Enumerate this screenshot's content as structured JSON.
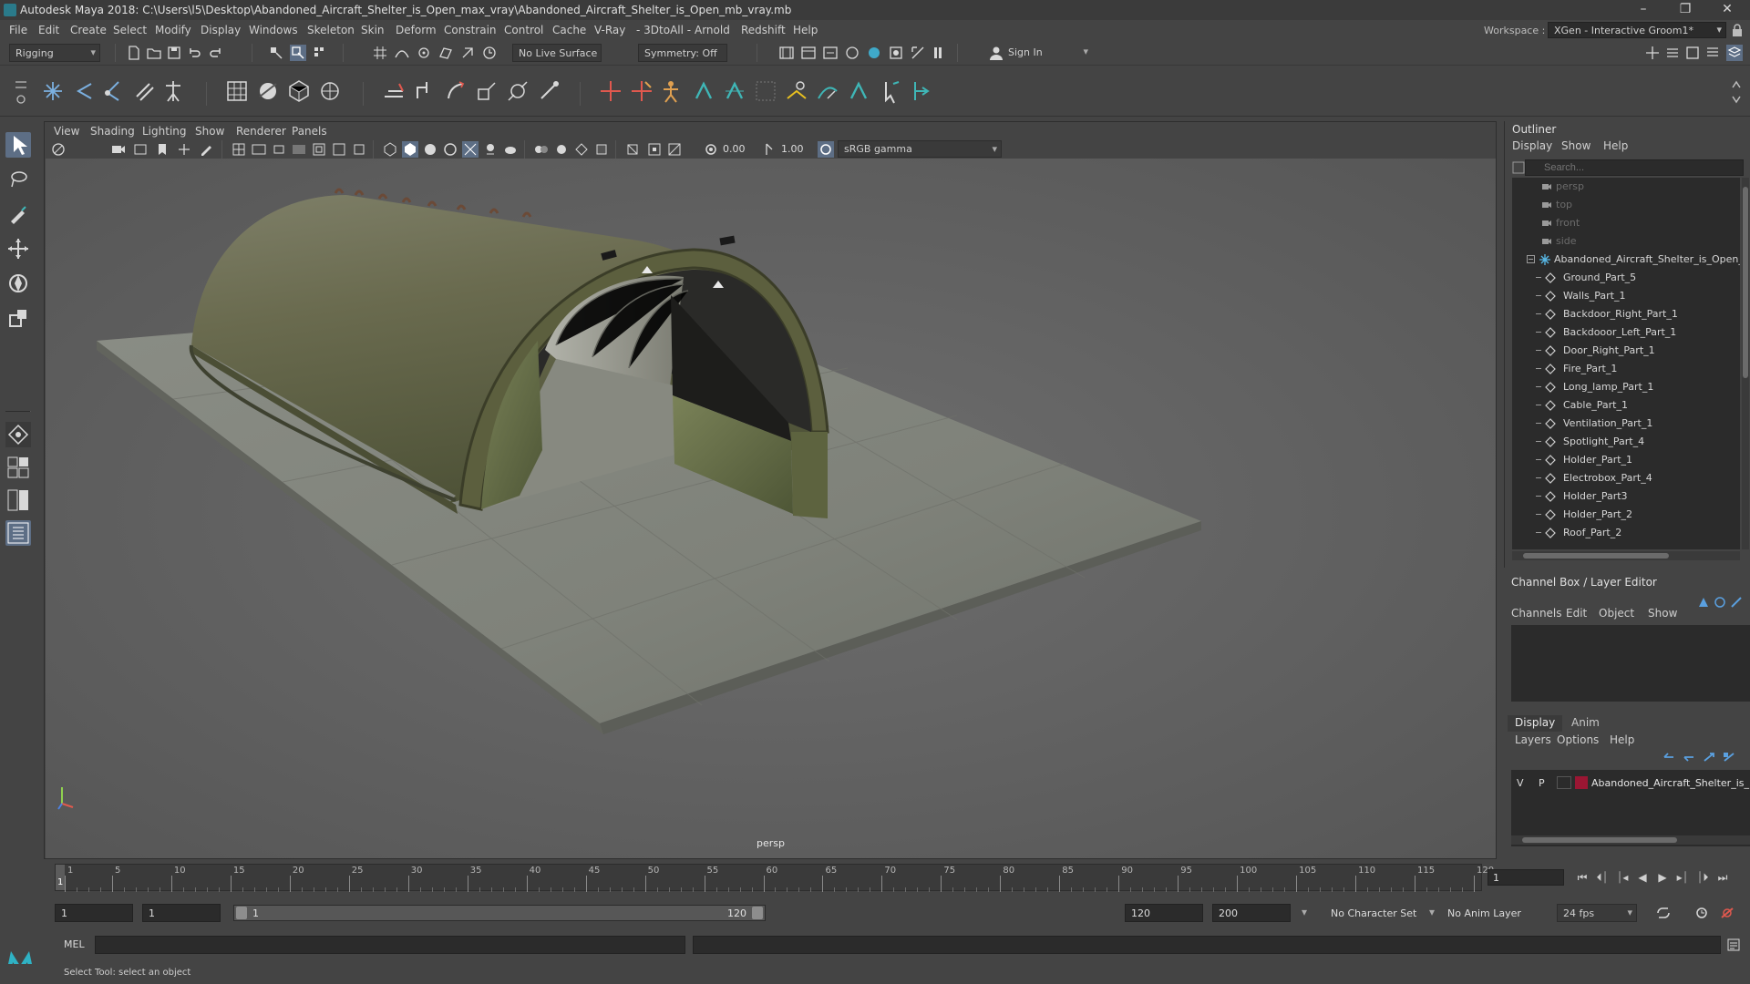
{
  "window": {
    "title": "Autodesk Maya 2018: C:\\Users\\l5\\Desktop\\Abandoned_Aircraft_Shelter_is_Open_max_vray\\Abandoned_Aircraft_Shelter_is_Open_mb_vray.mb",
    "minimize": "–",
    "maximize": "❐",
    "close": "✕"
  },
  "menubar": {
    "items": [
      "File",
      "Edit",
      "Create",
      "Select",
      "Modify",
      "Display",
      "Windows",
      "Skeleton",
      "Skin",
      "Deform",
      "Constrain",
      "Control",
      "Cache",
      "V-Ray",
      "- 3DtoAll -",
      "Arnold",
      "Redshift",
      "Help"
    ],
    "workspace_label": "Workspace :",
    "workspace_value": "XGen - Interactive Groom1*"
  },
  "statusline": {
    "menuset": "Rigging",
    "live_surface": "No Live Surface",
    "symmetry": "Symmetry: Off",
    "sign_in": "Sign In"
  },
  "viewport_panel": {
    "menus": [
      "View",
      "Shading",
      "Lighting",
      "Show",
      "Renderer",
      "Panels"
    ],
    "exposure": "0.00",
    "gamma": "1.00",
    "color_space": "sRGB gamma",
    "camera_label": "persp"
  },
  "outliner": {
    "title": "Outliner",
    "menus": [
      "Display",
      "Show",
      "Help"
    ],
    "search_placeholder": "Search...",
    "cameras": [
      "persp",
      "top",
      "front",
      "side"
    ],
    "root": "Abandoned_Aircraft_Shelter_is_Open_m",
    "children": [
      "Ground_Part_5",
      "Walls_Part_1",
      "Backdoor_Right_Part_1",
      "Backdooor_Left_Part_1",
      "Door_Right_Part_1",
      "Fire_Part_1",
      "Long_lamp_Part_1",
      "Cable_Part_1",
      "Ventilation_Part_1",
      "Spotlight_Part_4",
      "Holder_Part_1",
      "Electrobox_Part_4",
      "Holder_Part3",
      "Holder_Part_2",
      "Roof_Part_2"
    ]
  },
  "channelbox": {
    "title": "Channel Box / Layer Editor",
    "menus": [
      "Channels",
      "Edit",
      "Object",
      "Show"
    ]
  },
  "layereditor": {
    "tabs": [
      "Display",
      "Anim"
    ],
    "menus": [
      "Layers",
      "Options",
      "Help"
    ],
    "layer": {
      "v": "V",
      "p": "P",
      "name": "Abandoned_Aircraft_Shelter_is_",
      "color": "#9a1633"
    }
  },
  "timeslider": {
    "ticks": [
      "1",
      "5",
      "10",
      "15",
      "20",
      "25",
      "30",
      "35",
      "40",
      "45",
      "50",
      "55",
      "60",
      "65",
      "70",
      "75",
      "80",
      "85",
      "90",
      "95",
      "100",
      "105",
      "110",
      "115",
      "120"
    ],
    "current_frame": "1"
  },
  "rangeslider": {
    "start": "1",
    "playback_start": "1",
    "range_start": "1",
    "range_end": "120",
    "playback_end": "120",
    "end": "200",
    "character_set": "No Character Set",
    "anim_layer": "No Anim Layer",
    "fps": "24 fps"
  },
  "commandline": {
    "label": "MEL"
  },
  "helpline": {
    "text": "Select Tool: select an object"
  },
  "colors": {
    "accent": "#5d6e85",
    "panel_bg": "#444444",
    "field_bg": "#2b2b2b",
    "viewport_bg": "#6a6a6a"
  }
}
